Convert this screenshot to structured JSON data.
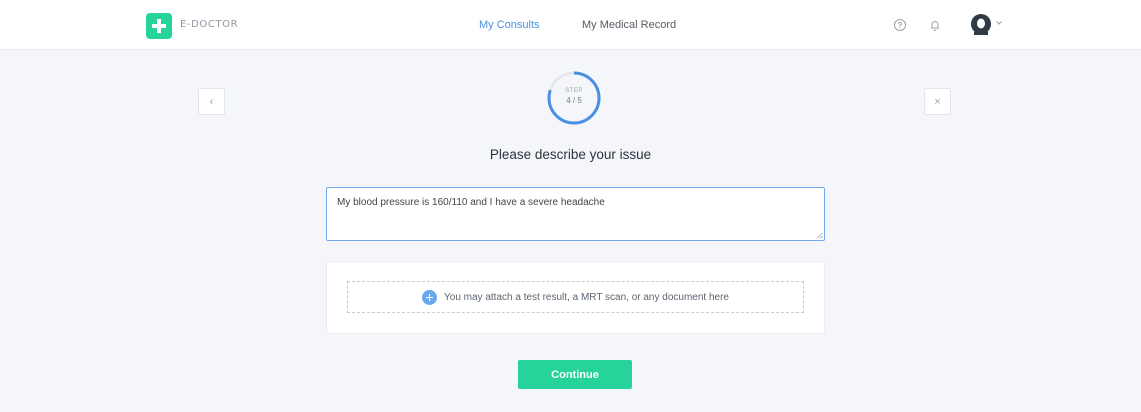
{
  "brand": {
    "name": "E-DOCTOR",
    "accent": "#26d39a"
  },
  "nav": [
    {
      "label": "My Consults",
      "active": true
    },
    {
      "label": "My Medical Record",
      "active": false
    }
  ],
  "header_icons": [
    "help-icon",
    "bell-icon",
    "avatar",
    "chevron-down-icon"
  ],
  "controls": {
    "back_label": "‹",
    "close_label": "×"
  },
  "progress": {
    "label": "STEP",
    "value": "4 / 5",
    "fraction": 0.8,
    "color": "#4a90e2"
  },
  "page": {
    "title": "Please describe your issue"
  },
  "issue_input": {
    "value": "My blood pressure is 160/110 and I have a severe headache"
  },
  "attachment": {
    "text": "You may attach a test result, a MRT scan, or any document here"
  },
  "actions": {
    "continue_label": "Continue"
  }
}
